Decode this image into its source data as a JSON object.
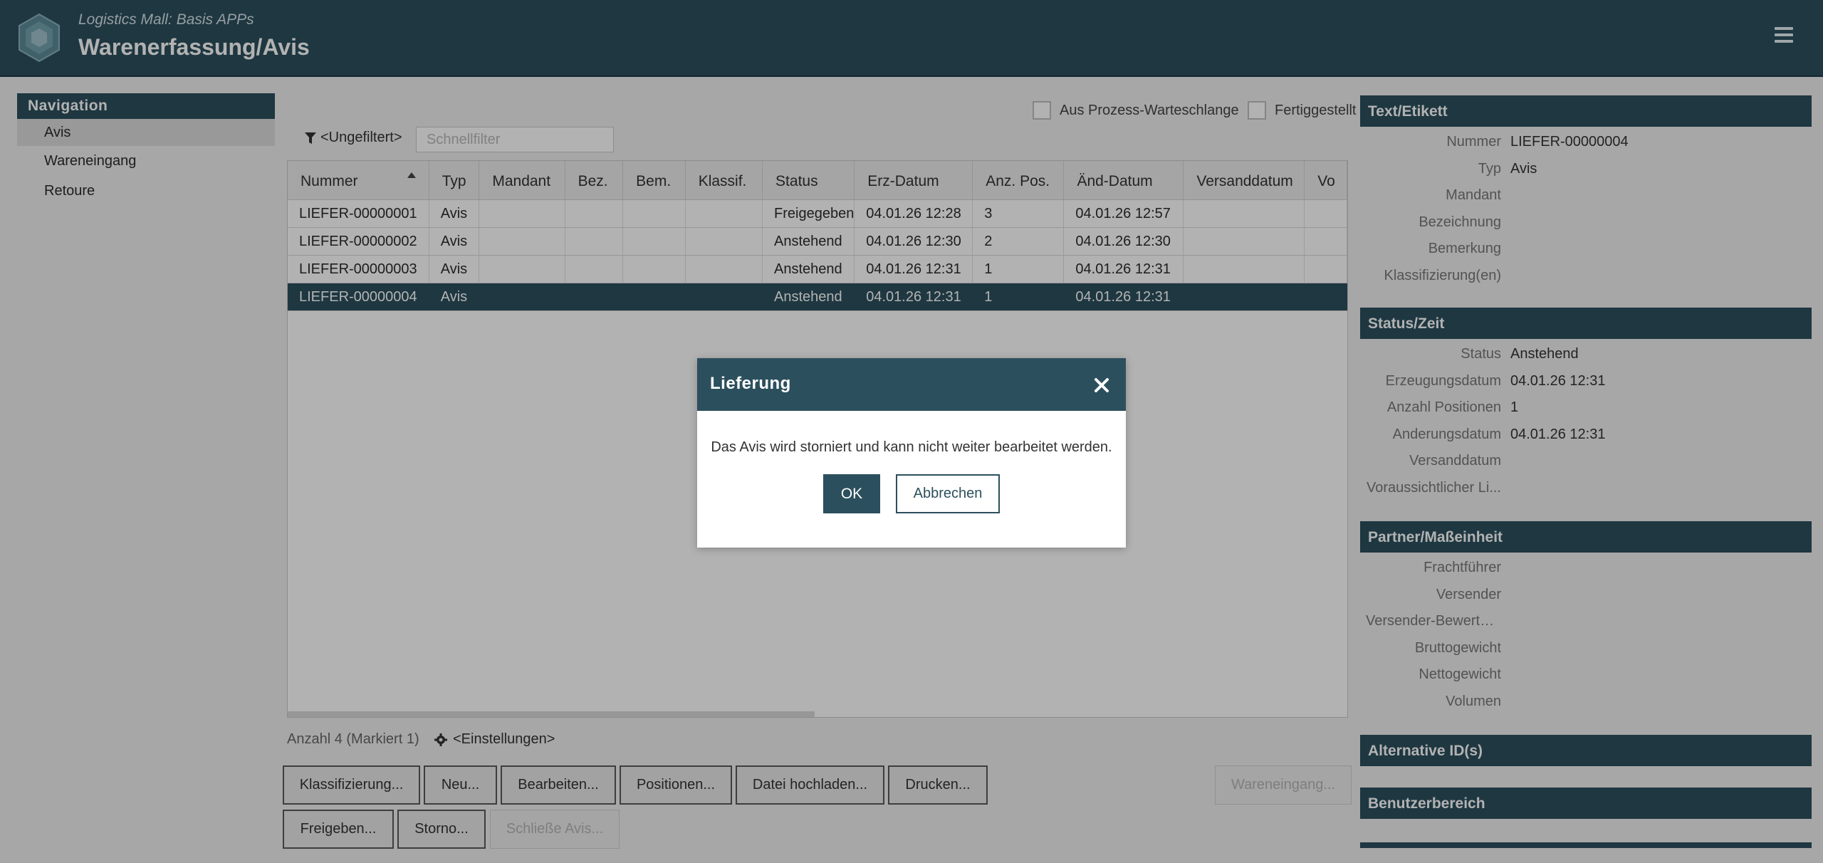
{
  "header": {
    "subtitle": "Logistics Mall: Basis APPs",
    "title": "Warenerfassung/Avis"
  },
  "nav": {
    "title": "Navigation",
    "items": [
      {
        "label": "Avis",
        "active": true
      },
      {
        "label": "Wareneingang",
        "active": false
      },
      {
        "label": "Retoure",
        "active": false
      }
    ]
  },
  "toolbar": {
    "process_queue_label": "Aus Prozess-Warteschlange",
    "finished_label": "Fertiggestellt",
    "filter_label": "<Ungefiltert>",
    "quickfilter_placeholder": "Schnellfilter"
  },
  "table": {
    "columns": [
      "Nummer",
      "Typ",
      "Mandant",
      "Bez.",
      "Bem.",
      "Klassif.",
      "Status",
      "Erz-Datum",
      "Anz. Pos.",
      "Änd-Datum",
      "Versanddatum",
      "Vo"
    ],
    "rows": [
      [
        "LIEFER-00000001",
        "Avis",
        "",
        "",
        "",
        "",
        "Freigegeben",
        "04.01.26 12:28",
        "3",
        "04.01.26 12:57",
        "",
        ""
      ],
      [
        "LIEFER-00000002",
        "Avis",
        "",
        "",
        "",
        "",
        "Anstehend",
        "04.01.26 12:30",
        "2",
        "04.01.26 12:30",
        "",
        ""
      ],
      [
        "LIEFER-00000003",
        "Avis",
        "",
        "",
        "",
        "",
        "Anstehend",
        "04.01.26 12:31",
        "1",
        "04.01.26 12:31",
        "",
        ""
      ],
      [
        "LIEFER-00000004",
        "Avis",
        "",
        "",
        "",
        "",
        "Anstehend",
        "04.01.26 12:31",
        "1",
        "04.01.26 12:31",
        "",
        ""
      ]
    ],
    "selected_row": 3
  },
  "footer": {
    "count": "Anzahl 4 (Markiert 1)",
    "settings": "<Einstellungen>"
  },
  "buttons": {
    "classify": "Klassifizierung...",
    "new": "Neu...",
    "edit": "Bearbeiten...",
    "positions": "Positionen...",
    "upload": "Datei hochladen...",
    "print": "Drucken...",
    "goods_receipt": "Wareneingang...",
    "release": "Freigeben...",
    "cancel": "Storno...",
    "close_avis": "Schließe Avis..."
  },
  "detail": {
    "text_section": {
      "title": "Text/Etikett",
      "fields": [
        {
          "label": "Nummer",
          "value": "LIEFER-00000004"
        },
        {
          "label": "Typ",
          "value": "Avis"
        },
        {
          "label": "Mandant",
          "value": ""
        },
        {
          "label": "Bezeichnung",
          "value": ""
        },
        {
          "label": "Bemerkung",
          "value": ""
        },
        {
          "label": "Klassifizierung(en)",
          "value": ""
        }
      ]
    },
    "status_section": {
      "title": "Status/Zeit",
      "fields": [
        {
          "label": "Status",
          "value": "Anstehend"
        },
        {
          "label": "Erzeugungsdatum",
          "value": "04.01.26 12:31"
        },
        {
          "label": "Anzahl Positionen",
          "value": "1"
        },
        {
          "label": "Anderungsdatum",
          "value": "04.01.26 12:31"
        },
        {
          "label": "Versanddatum",
          "value": ""
        },
        {
          "label": "Voraussichtlicher Li...",
          "value": ""
        }
      ]
    },
    "partner_section": {
      "title": "Partner/Maßeinheit",
      "fields": [
        {
          "label": "Frachtführer",
          "value": ""
        },
        {
          "label": "Versender",
          "value": ""
        },
        {
          "label": "Versender-Bewertung",
          "value": ""
        },
        {
          "label": "Bruttogewicht",
          "value": ""
        },
        {
          "label": "Nettogewicht",
          "value": ""
        },
        {
          "label": "Volumen",
          "value": ""
        }
      ]
    },
    "alt_ids_title": "Alternative ID(s)",
    "user_area_title": "Benutzerbereich"
  },
  "dialog": {
    "title": "Lieferung",
    "message": "Das Avis wird storniert und kann nicht weiter bearbeitet werden.",
    "ok": "OK",
    "cancel": "Abbrechen"
  },
  "colors": {
    "primary": "#2c4f5d",
    "background": "#efefef"
  }
}
